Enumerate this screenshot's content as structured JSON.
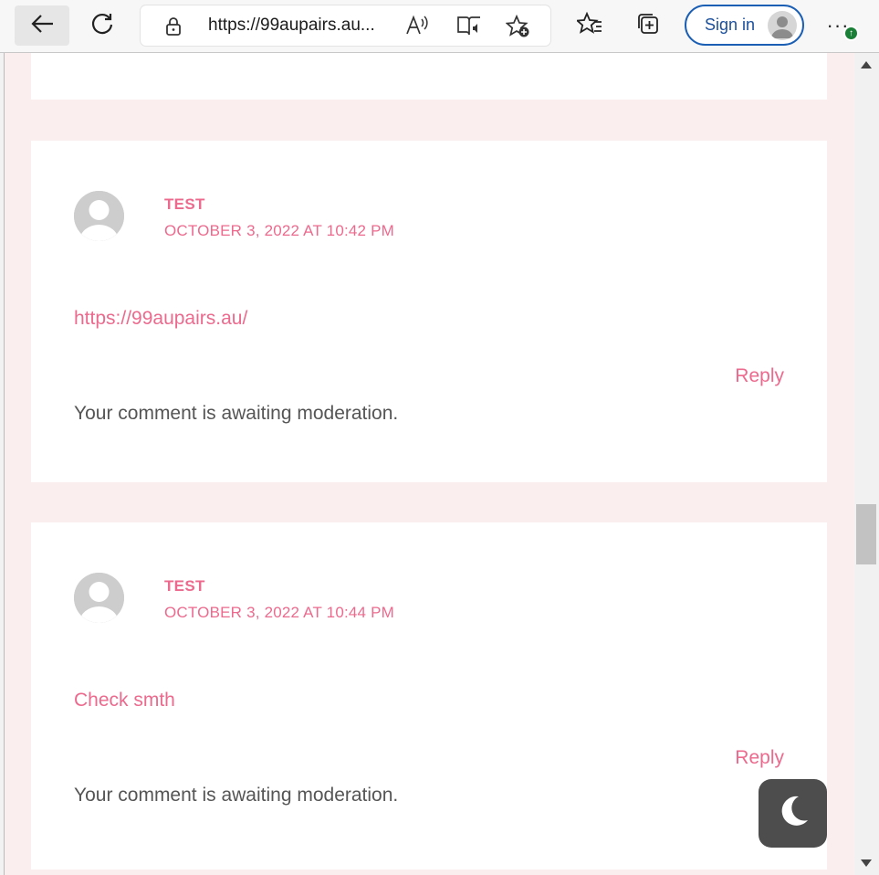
{
  "browser": {
    "url": "https://99aupairs.au...",
    "read_aloud_glyph": "A))",
    "signin_label": "Sign in",
    "more_glyph": "···",
    "update_glyph": "↑",
    "icons": [
      "back-arrow-icon",
      "refresh-icon",
      "lock-icon",
      "read-aloud-icon",
      "immersive-reader-icon",
      "add-favorite-icon",
      "favorites-icon",
      "collections-icon",
      "profile-icon",
      "more-icon"
    ]
  },
  "comments": [
    {
      "author": "TEST",
      "date": "OCTOBER 3, 2022 AT 10:42 PM",
      "content": "https://99aupairs.au/",
      "reply_label": "Reply",
      "moderation": "Your comment is awaiting moderation."
    },
    {
      "author": "TEST",
      "date": "OCTOBER 3, 2022 AT 10:44 PM",
      "content": "Check smth",
      "reply_label": "Reply",
      "moderation": "Your comment is awaiting moderation."
    }
  ],
  "colors": {
    "accent": "#ec6a8e",
    "page_background": "#fbeeee",
    "card_background": "#ffffff",
    "body_text": "#555555",
    "toggle_background": "#4d4d4d"
  }
}
